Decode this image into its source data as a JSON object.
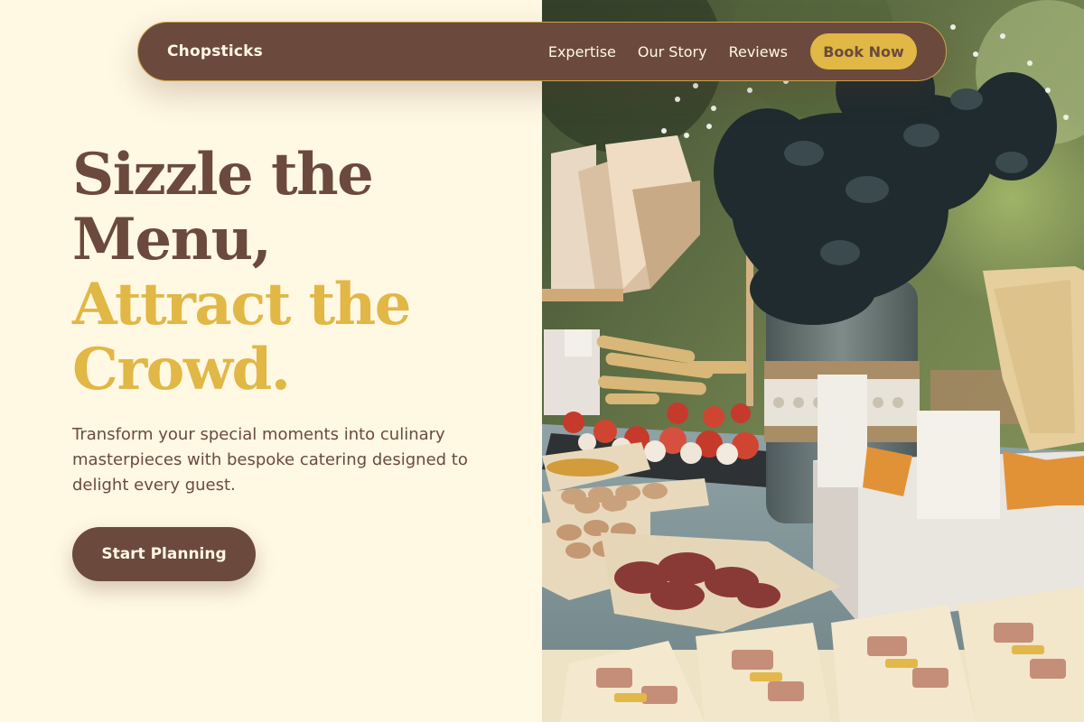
{
  "nav": {
    "brand": "Chopsticks",
    "links": [
      "Expertise",
      "Our Story",
      "Reviews"
    ],
    "book_button": "Book Now"
  },
  "hero": {
    "title_line1": "Sizzle the",
    "title_line2": "Menu,",
    "title_line3": "Attract the",
    "title_line4": "Crowd.",
    "subtitle": "Transform your special moments into culinary masterpieces with bespoke catering designed to delight every guest.",
    "cta_label": "Start Planning"
  },
  "colors": {
    "background": "#fff8e3",
    "brown": "#6b4a3d",
    "gold": "#e1b745"
  }
}
